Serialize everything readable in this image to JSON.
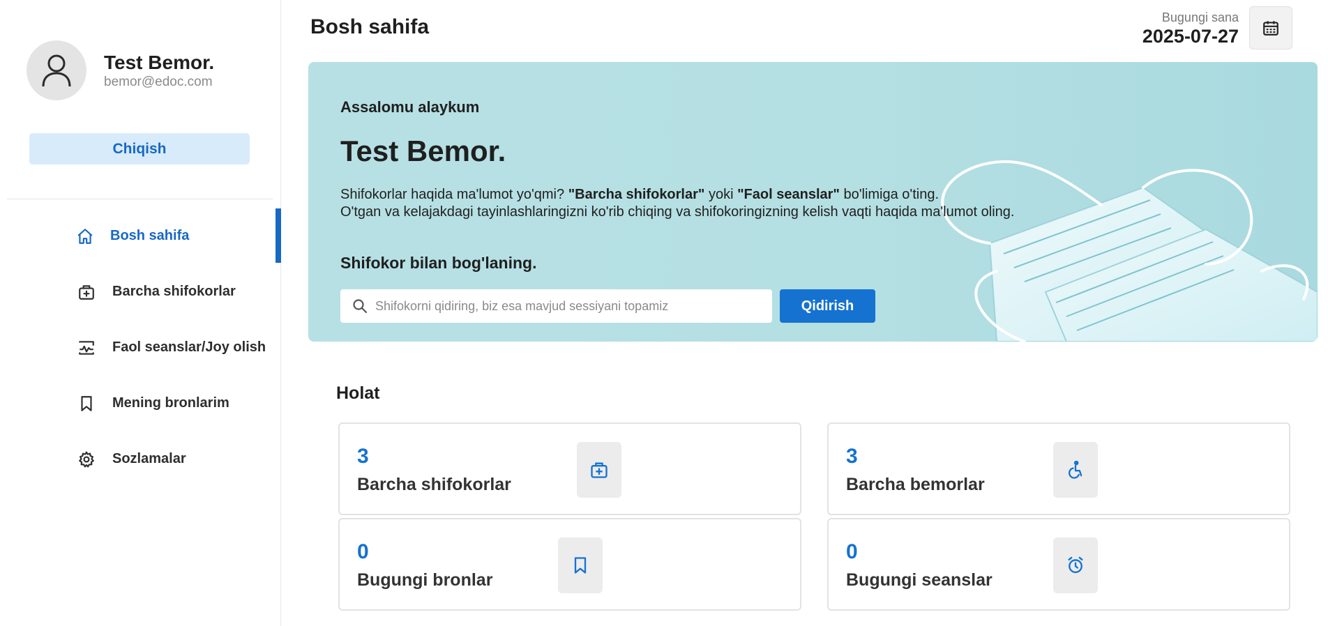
{
  "sidebar": {
    "profile": {
      "name": "Test Bemor.",
      "email": "bemor@edoc.com"
    },
    "logout_label": "Chiqish",
    "items": [
      {
        "label": "Bosh sahifa",
        "icon": "home-icon",
        "active": true
      },
      {
        "label": "Barcha shifokorlar",
        "icon": "medical-bag-icon"
      },
      {
        "label": "Faol seanslar/Joy olish",
        "icon": "activity-icon"
      },
      {
        "label": "Mening bronlarim",
        "icon": "bookmark-icon"
      },
      {
        "label": "Sozlamalar",
        "icon": "gear-icon"
      }
    ]
  },
  "header": {
    "title": "Bosh sahifa",
    "date_label": "Bugungi sana",
    "date_value": "2025-07-27",
    "calendar_icon": "calendar-icon"
  },
  "banner": {
    "greeting": "Assalomu alaykum",
    "name": "Test Bemor.",
    "desc_line1_a": "Shifokorlar haqida ma'lumot yo'qmi? ",
    "desc_line1_b": "\"Barcha shifokorlar\"",
    "desc_line1_c": " yoki ",
    "desc_line1_d": "\"Faol seanslar\"",
    "desc_line1_e": " bo'limiga o'ting.",
    "desc_line2": "O'tgan va kelajakdagi tayinlashlaringizni ko'rib chiqing va shifokoringizning kelish vaqti haqida ma'lumot oling.",
    "contact_title": "Shifokor bilan bog'laning.",
    "search_placeholder": "Shifokorni qidiring, biz esa mavjud sessiyani topamiz",
    "search_value": "",
    "search_button": "Qidirish"
  },
  "status": {
    "title": "Holat",
    "cards": [
      {
        "value": "3",
        "label": "Barcha shifokorlar",
        "icon": "medical-bag-icon"
      },
      {
        "value": "3",
        "label": "Barcha bemorlar",
        "icon": "wheelchair-icon"
      },
      {
        "value": "0",
        "label": "Bugungi bronlar",
        "icon": "bookmark-icon"
      },
      {
        "value": "0",
        "label": "Bugungi seanslar",
        "icon": "alarm-clock-icon"
      }
    ]
  },
  "colors": {
    "accent": "#1572d1",
    "logout_bg": "#d8ebfb",
    "banner_bg": "#b4dfe3"
  }
}
